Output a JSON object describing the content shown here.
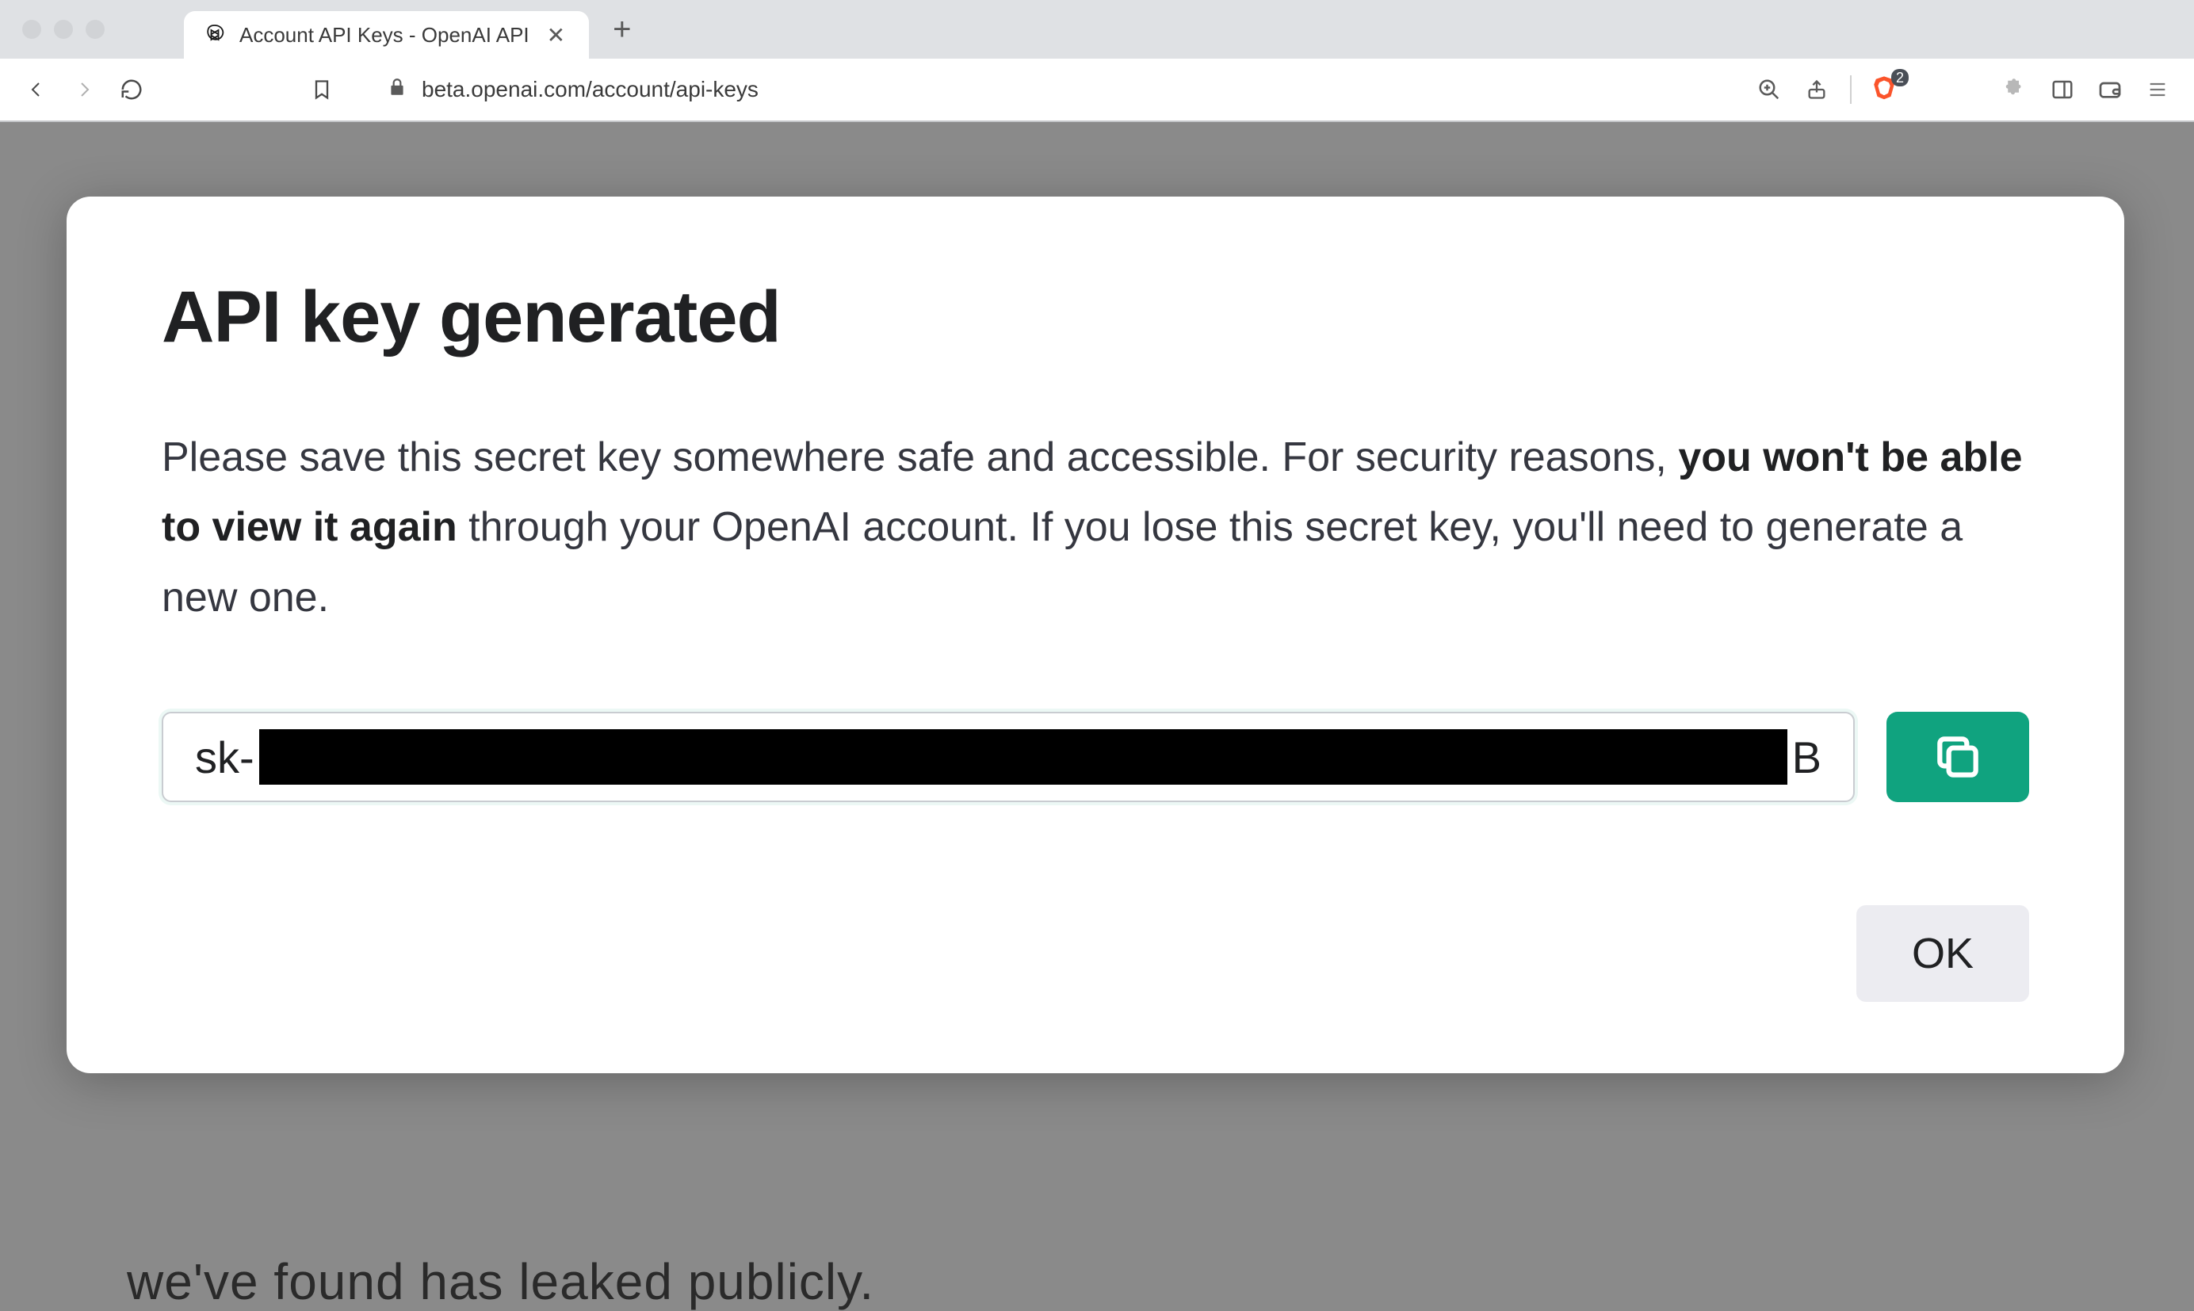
{
  "browser": {
    "tab_title": "Account API Keys - OpenAI API",
    "url_host": "beta.openai.com",
    "url_path": "/account/api-keys",
    "shield_badge": "2"
  },
  "background_page": {
    "visible_text_fragment": "we've found has leaked publicly."
  },
  "modal": {
    "title": "API key generated",
    "body_prefix": "Please save this secret key somewhere safe and accessible. For security reasons, ",
    "body_bold": "you won't be able to view it again",
    "body_suffix": " through your OpenAI account. If you lose this secret key, you'll need to generate a new one.",
    "key_prefix": "sk-",
    "key_suffix": "B",
    "ok_label": "OK"
  }
}
